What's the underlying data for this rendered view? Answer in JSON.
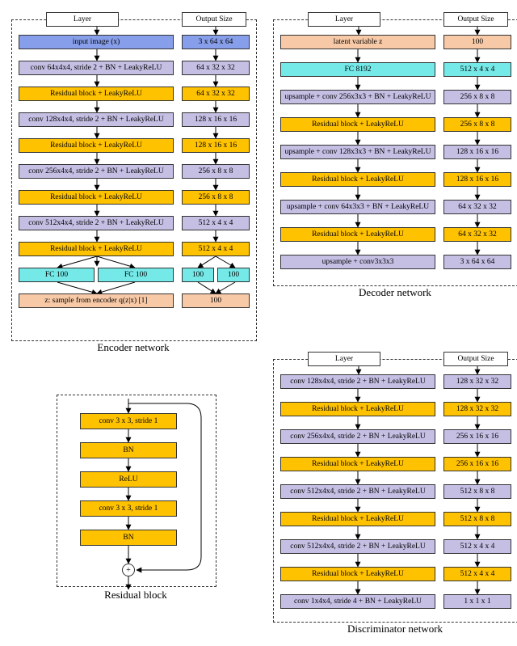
{
  "chart_data": [
    {
      "type": "table",
      "title": "Encoder network",
      "columns": [
        "Layer",
        "Output Size"
      ],
      "rows": [
        {
          "layer": "input image (x)",
          "out": "3 x 64 x 64",
          "kind": "input"
        },
        {
          "layer": "conv 64x4x4, stride 2 + BN + LeakyReLU",
          "out": "64 x 32 x 32",
          "kind": "conv"
        },
        {
          "layer": "Residual block  + LeakyReLU",
          "out": "64 x 32 x 32",
          "kind": "res"
        },
        {
          "layer": "conv 128x4x4, stride 2 + BN + LeakyReLU",
          "out": "128 x 16 x 16",
          "kind": "conv"
        },
        {
          "layer": "Residual block  + LeakyReLU",
          "out": "128 x 16 x 16",
          "kind": "res"
        },
        {
          "layer": "conv 256x4x4, stride 2 + BN + LeakyReLU",
          "out": "256 x 8 x 8",
          "kind": "conv"
        },
        {
          "layer": "Residual block  + LeakyReLU",
          "out": "256 x 8 x 8",
          "kind": "res"
        },
        {
          "layer": "conv 512x4x4, stride 2 + BN + LeakyReLU",
          "out": "512 x 4 x 4",
          "kind": "conv"
        },
        {
          "layer": "Residual block  + LeakyReLU",
          "out": "512 x 4 x 4",
          "kind": "res"
        }
      ],
      "fc": {
        "left": "FC 100",
        "right": "FC 100",
        "out_left": "100",
        "out_right": "100"
      },
      "tail": {
        "layer": "z: sample from encoder q(z|x) [1]",
        "out": "100"
      }
    },
    {
      "type": "table",
      "title": "Decoder network",
      "columns": [
        "Layer",
        "Output Size"
      ],
      "rows": [
        {
          "layer": "latent variable z",
          "out": "100",
          "kind": "latent"
        },
        {
          "layer": "FC 8192",
          "out": "512 x 4 x 4",
          "kind": "fc"
        },
        {
          "layer": "upsample + conv 256x3x3 + BN + LeakyReLU",
          "out": "256 x 8 x 8",
          "kind": "conv"
        },
        {
          "layer": "Residual block + LeakyReLU",
          "out": "256 x 8 x 8",
          "kind": "res"
        },
        {
          "layer": "upsample + conv 128x3x3 + BN + LeakyReLU",
          "out": "128 x 16 x 16",
          "kind": "conv"
        },
        {
          "layer": "Residual block + LeakyReLU",
          "out": "128 x 16 x 16",
          "kind": "res"
        },
        {
          "layer": "upsample + conv 64x3x3 + BN + LeakyReLU",
          "out": "64 x 32 x 32",
          "kind": "conv"
        },
        {
          "layer": "Residual block + LeakyReLU",
          "out": "64 x 32 x 32",
          "kind": "res"
        },
        {
          "layer": "upsample + conv3x3x3",
          "out": "3 x 64 x 64",
          "kind": "conv"
        }
      ]
    },
    {
      "type": "table",
      "title": "Residual block",
      "rows": [
        {
          "layer": "conv 3 x 3, stride 1",
          "kind": "res"
        },
        {
          "layer": "BN",
          "kind": "res"
        },
        {
          "layer": "ReLU",
          "kind": "res"
        },
        {
          "layer": "conv 3 x 3, stride 1",
          "kind": "res"
        },
        {
          "layer": "BN",
          "kind": "res"
        }
      ],
      "sum": "+"
    },
    {
      "type": "table",
      "title": "Discriminator network",
      "columns": [
        "Layer",
        "Output Size"
      ],
      "rows": [
        {
          "layer": "conv 128x4x4, stride 2 + BN + LeakyReLU",
          "out": "128 x 32 x 32",
          "kind": "conv"
        },
        {
          "layer": "Residual block + LeakyReLU",
          "out": "128 x 32 x 32",
          "kind": "res"
        },
        {
          "layer": "conv 256x4x4, stride 2 + BN + LeakyReLU",
          "out": "256 x 16 x 16",
          "kind": "conv"
        },
        {
          "layer": "Residual block + LeakyReLU",
          "out": "256 x 16 x 16",
          "kind": "res"
        },
        {
          "layer": "conv 512x4x4, stride 2 + BN + LeakyReLU",
          "out": "512 x 8 x 8",
          "kind": "conv"
        },
        {
          "layer": "Residual block + LeakyReLU",
          "out": "512 x 8 x 8",
          "kind": "res"
        },
        {
          "layer": "conv 512x4x4, stride 2 + BN + LeakyReLU",
          "out": "512 x 4 x 4",
          "kind": "conv"
        },
        {
          "layer": "Residual block + LeakyReLU",
          "out": "512 x 4 x 4",
          "kind": "res"
        },
        {
          "layer": "conv 1x4x4, stride 4 + BN + LeakyReLU",
          "out": "1 x 1 x 1",
          "kind": "conv"
        }
      ]
    }
  ]
}
